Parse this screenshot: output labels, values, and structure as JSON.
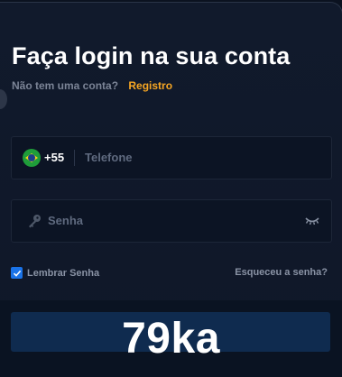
{
  "login": {
    "title": "Faça login na sua conta",
    "no_account_text": "Não tem uma conta?",
    "register_link": "Registro",
    "phone": {
      "country_code": "+55",
      "placeholder": "Telefone"
    },
    "password": {
      "placeholder": "Senha"
    },
    "remember_label": "Lembrar Senha",
    "remember_checked": true,
    "forgot_link": "Esqueceu a senha?",
    "watermark": "79ka"
  },
  "icons": {
    "flag": "brazil-flag-icon",
    "key": "key-icon",
    "eye": "eye-closed-icon",
    "check": "check-icon"
  },
  "colors": {
    "background": "#111a2c",
    "accent_link": "#f6a623",
    "checkbox": "#1a73e8",
    "button": "#0f2b4f"
  }
}
